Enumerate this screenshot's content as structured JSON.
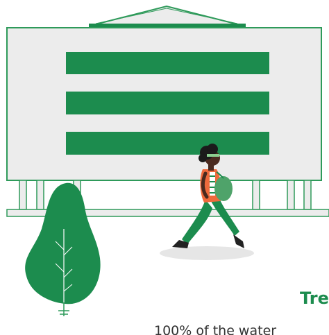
{
  "colors": {
    "brand_green": "#1c8c4e",
    "building_fill": "#ececec",
    "outline": "#2e9a5a",
    "skin": "#4a2a1f",
    "shirt": "#ef6a3c",
    "shadow": "#e6e6e6"
  },
  "section": {
    "heading": "Tre",
    "body": "100% of the water"
  },
  "illustration": {
    "icons": [
      "building-illustration",
      "tree-illustration",
      "walking-person-illustration"
    ]
  }
}
